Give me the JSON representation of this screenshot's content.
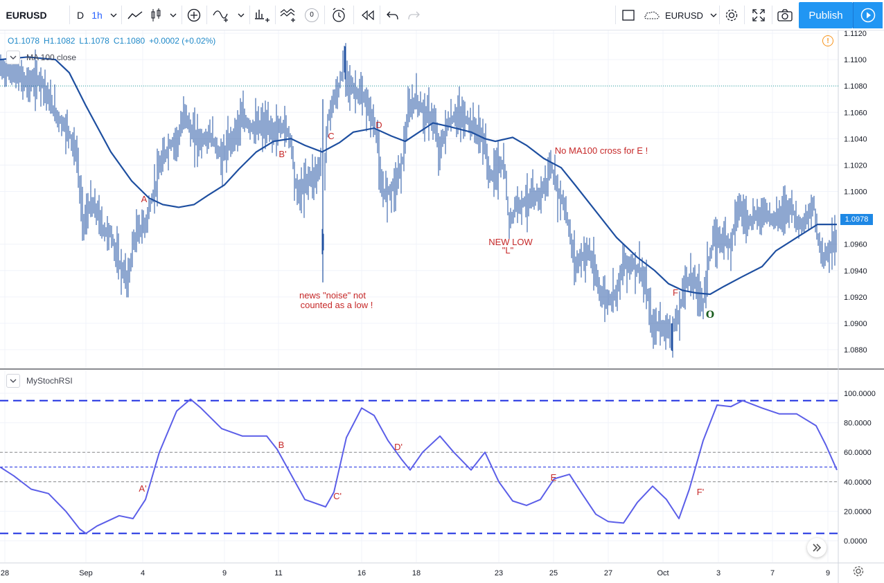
{
  "toolbar": {
    "symbol": "EURUSD",
    "period_d": "D",
    "interval": "1h",
    "publish": "Publish",
    "compare_symbol": "EURUSD",
    "replay_badge": "0"
  },
  "main_pane": {
    "ohlc": {
      "o": "O1.1078",
      "h": "H1.1082",
      "l": "L1.1078",
      "c": "C1.1080",
      "chg": "+0.0002 (+0.02%)"
    },
    "indicator_label": "MA 100 close",
    "last_price": "1.0978",
    "y_ticks": [
      "1.1120",
      "1.1100",
      "1.1080",
      "1.1060",
      "1.1040",
      "1.1020",
      "1.1000",
      "1.0960",
      "1.0940",
      "1.0920",
      "1.0900",
      "1.0880"
    ],
    "y_min": 1.087,
    "y_max": 1.1125,
    "ref_level": 1.108,
    "annotations": [
      {
        "text": "A",
        "color": "#c62828"
      },
      {
        "text": "B'",
        "color": "#c62828"
      },
      {
        "text": "C",
        "color": "#c62828"
      },
      {
        "text": "D",
        "color": "#c62828"
      },
      {
        "text": "No MA100 cross for E !",
        "color": "#c62828"
      },
      {
        "text": "NEW LOW",
        "color": "#c62828"
      },
      {
        "text": "\"L\"",
        "color": "#c62828"
      },
      {
        "text": "news \"noise\" not",
        "color": "#c62828"
      },
      {
        "text": "counted as a low !",
        "color": "#c62828"
      },
      {
        "text": "F",
        "color": "#c62828"
      },
      {
        "text": "O",
        "color": "#1b5e20"
      }
    ],
    "ma_color": "#1e4fa0",
    "candle_color": "#1e4fa0"
  },
  "sub_pane": {
    "indicator_label": "MyStochRSI",
    "y_ticks": [
      "100.0000",
      "80.0000",
      "60.0000",
      "40.0000",
      "20.0000",
      "0.0000"
    ],
    "annotations": [
      "A'",
      "B",
      "C'",
      "D'",
      "E",
      "F'"
    ],
    "line_color": "#5b5ee8"
  },
  "x_ticks": [
    "28",
    "Sep",
    "4",
    "9",
    "11",
    "16",
    "18",
    "23",
    "25",
    "27",
    "Oct",
    "3",
    "7",
    "9"
  ],
  "chart_data": [
    {
      "type": "line",
      "title": "EURUSD, 1h",
      "series": [
        {
          "name": "MA 100 close",
          "x": [
            "28",
            "Sep",
            "4",
            "9",
            "11",
            "16",
            "18",
            "23",
            "25",
            "27",
            "Oct",
            "3",
            "7",
            "9"
          ],
          "values": [
            1.11,
            1.1065,
            1.0993,
            1.1005,
            1.104,
            1.1048,
            1.105,
            1.104,
            1.1022,
            1.0968,
            1.0926,
            1.0932,
            1.0955,
            1.0972
          ]
        }
      ],
      "price_approx": {
        "x": [
          "28",
          "Sep",
          "4",
          "9",
          "11",
          "16",
          "18",
          "23",
          "25",
          "27",
          "Oct",
          "3",
          "7",
          "9"
        ],
        "values": [
          1.109,
          1.096,
          1.098,
          1.103,
          1.1045,
          1.1085,
          1.107,
          1.101,
          1.101,
          1.0925,
          1.089,
          1.096,
          1.099,
          1.096
        ]
      },
      "ylim": [
        1.087,
        1.1125
      ],
      "horizontal_line": 1.108,
      "last_value": 1.0978
    },
    {
      "type": "line",
      "title": "MyStochRSI",
      "series": [
        {
          "name": "MyStochRSI",
          "x": [
            "28",
            "Sep",
            "4",
            "9",
            "11",
            "16",
            "18",
            "23",
            "25",
            "27",
            "Oct",
            "3",
            "7",
            "9"
          ],
          "values": [
            50,
            6,
            40,
            75,
            62,
            90,
            52,
            47,
            35,
            12,
            18,
            93,
            86,
            48
          ]
        }
      ],
      "levels": [
        95,
        60,
        50,
        40,
        5
      ],
      "ylim": [
        -5,
        105
      ]
    }
  ]
}
